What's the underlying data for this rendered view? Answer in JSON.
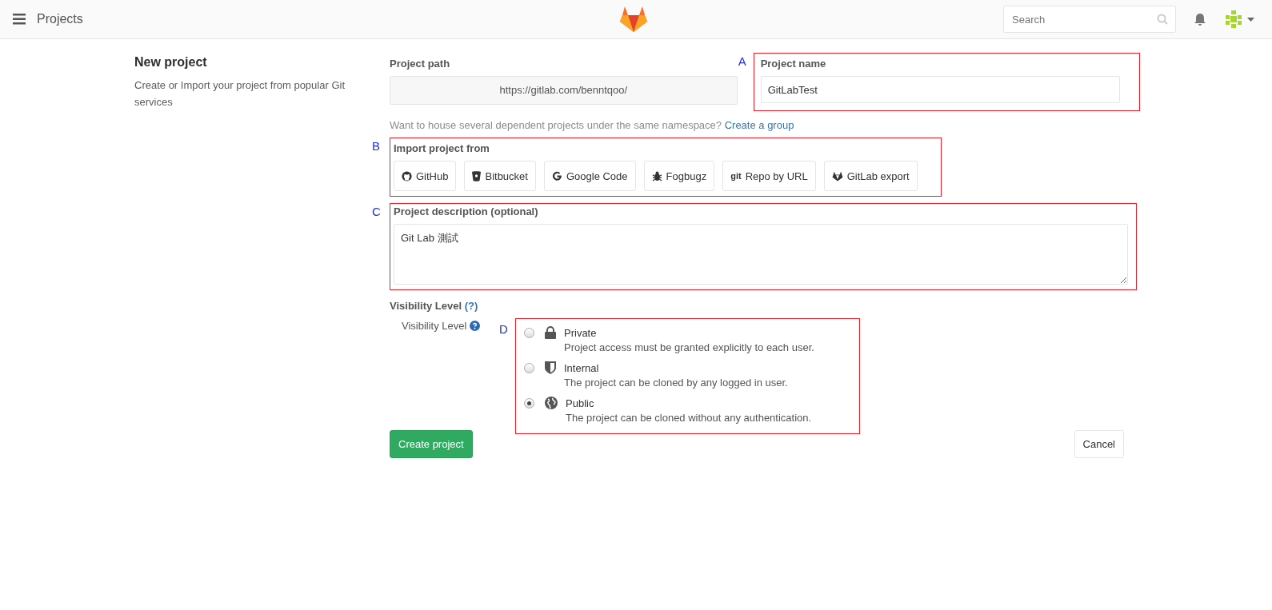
{
  "header": {
    "title": "Projects",
    "search": {
      "placeholder": "Search"
    }
  },
  "sidebar": {
    "title": "New project",
    "description": "Create or Import your project from popular Git services"
  },
  "path": {
    "label": "Project path",
    "value": "https://gitlab.com/benntqoo/"
  },
  "name": {
    "annotation": "A",
    "label": "Project name",
    "value": "GitLabTest"
  },
  "group_hint": {
    "text": "Want to house several dependent projects under the same namespace?",
    "link": "Create a group"
  },
  "import": {
    "annotation": "B",
    "label": "Import project from",
    "sources": [
      {
        "kind": "github",
        "label": "GitHub"
      },
      {
        "kind": "bitbucket",
        "label": "Bitbucket"
      },
      {
        "kind": "google",
        "label": "Google Code"
      },
      {
        "kind": "bug",
        "label": "Fogbugz"
      },
      {
        "kind": "git",
        "icon_text": "git",
        "label": "Repo by URL"
      },
      {
        "kind": "gitlab",
        "label": "GitLab export"
      }
    ]
  },
  "description": {
    "annotation": "C",
    "label": "Project description (optional)",
    "value": "Git Lab 測試"
  },
  "visibility": {
    "heading": "Visibility Level",
    "help_link": "(?)",
    "label": "Visibility Level",
    "annotation": "D",
    "options": [
      {
        "kind": "lock",
        "label": "Private",
        "detail": "Project access must be granted explicitly to each user.",
        "selected": false
      },
      {
        "kind": "shield",
        "label": "Internal",
        "detail": "The project can be cloned by any logged in user.",
        "selected": false
      },
      {
        "kind": "globe",
        "label": "Public",
        "detail": "The project can be cloned without any authentication.",
        "selected": true
      }
    ]
  },
  "buttons": {
    "create": "Create project",
    "cancel": "Cancel"
  }
}
